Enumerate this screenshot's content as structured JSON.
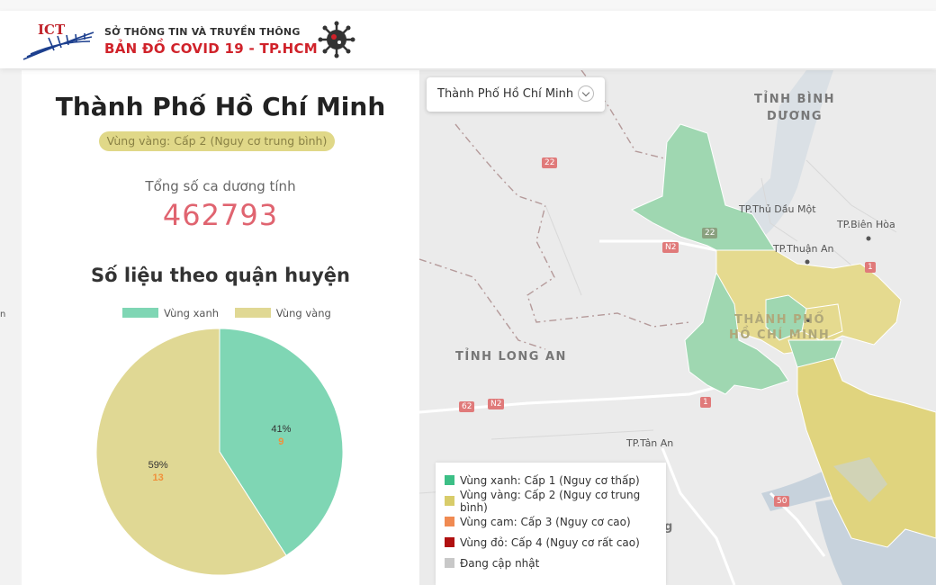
{
  "header": {
    "line1": "SỞ THÔNG TIN VÀ TRUYỀN THÔNG",
    "line2": "BẢN ĐỒ  COVID 19 - TP.HCM",
    "logo_text": "ICT"
  },
  "left_edge_text": "n",
  "summary": {
    "city": "Thành Phố Hồ Chí Minh",
    "zone_badge": "Vùng vàng: Cấp 2 (Nguy cơ trung bình)",
    "total_label": "Tổng số ca dương tính",
    "total_value": "462793",
    "stats_title": "Số liệu theo quận huyện"
  },
  "chart_data": {
    "type": "pie",
    "legend": [
      "Vùng xanh",
      "Vùng vàng"
    ],
    "slices": [
      {
        "name": "Vùng xanh",
        "percent": "41%",
        "count": "9",
        "value": 9,
        "color": "#7fd6b4"
      },
      {
        "name": "Vùng vàng",
        "percent": "59%",
        "count": "13",
        "value": 13,
        "color": "#e0d894"
      }
    ]
  },
  "map": {
    "dropdown_value": "Thành Phố Hồ Chí Minh",
    "labels": {
      "binh_duong_1": "TỈNH BÌNH",
      "binh_duong_2": "DƯƠNG",
      "long_an": "TỈNH LONG AN",
      "hcm_1": "THÀNH PHỐ",
      "hcm_2": "HỒ CHÍ MINH",
      "thu_dau_mot": "TP.Thủ Dầu Một",
      "bien_hoa": "TP.Biên Hòa",
      "thuan_an": "TP.Thuận An",
      "tan_an": "TP.Tân An",
      "partial_g": "g"
    },
    "roads": [
      "22",
      "22",
      "N2",
      "1",
      "1",
      "62",
      "N2",
      "50"
    ],
    "legend": [
      {
        "label": "Vùng xanh: Cấp 1 (Nguy cơ thấp)",
        "color": "#3cbf86"
      },
      {
        "label": "Vùng vàng: Cấp 2 (Nguy cơ trung bình)",
        "color": "#d8cc6a"
      },
      {
        "label": "Vùng cam: Cấp 3 (Nguy cơ cao)",
        "color": "#f08a52"
      },
      {
        "label": "Vùng đỏ: Cấp 4 (Nguy cơ rất cao)",
        "color": "#b01010"
      },
      {
        "label": "Đang cập nhật",
        "color": "#c8c8c8"
      }
    ]
  }
}
